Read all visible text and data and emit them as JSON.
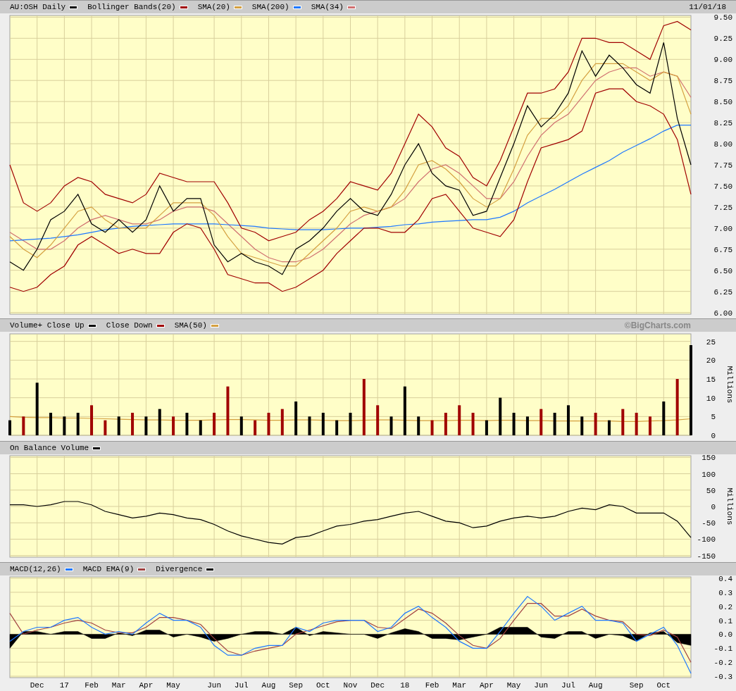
{
  "panels": [
    {
      "date": "11/01/18",
      "chart_data": {
        "type": "line",
        "categories": [
          null,
          null,
          null,
          null,
          null,
          null,
          null,
          null,
          null,
          null,
          null,
          null,
          null,
          null,
          null,
          null,
          null,
          null,
          null,
          null,
          null,
          null,
          null,
          null,
          null,
          null,
          null,
          null,
          null,
          null,
          null,
          null,
          null,
          null,
          null,
          null,
          null,
          null,
          null,
          null,
          null,
          null,
          null,
          null,
          null,
          null,
          null,
          null,
          null,
          null,
          null
        ],
        "ylim": [
          5.98,
          9.52
        ],
        "grid": true,
        "yticks": [
          {
            "value": 6,
            "label": "6.00"
          },
          {
            "value": 6.25,
            "label": "6.25"
          },
          {
            "value": 6.5,
            "label": "6.50"
          },
          {
            "value": 6.75,
            "label": "6.75"
          },
          {
            "value": 7,
            "label": "7.00"
          },
          {
            "value": 7.25,
            "label": "7.25"
          },
          {
            "value": 7.5,
            "label": "7.50"
          },
          {
            "value": 7.75,
            "label": "7.75"
          },
          {
            "value": 8,
            "label": "8.00"
          },
          {
            "value": 8.25,
            "label": "8.25"
          },
          {
            "value": 8.5,
            "label": "8.50"
          },
          {
            "value": 8.75,
            "label": "8.75"
          },
          {
            "value": 9,
            "label": "9.00"
          },
          {
            "value": 9.25,
            "label": "9.25"
          },
          {
            "value": 9.5,
            "label": "9.50"
          }
        ],
        "series": [
          {
            "name": "AU:OSH Daily",
            "color": "#000000",
            "values": [
              6.6,
              6.5,
              6.75,
              7.1,
              7.2,
              7.4,
              7.05,
              6.95,
              7.1,
              6.95,
              7.1,
              7.5,
              7.2,
              7.35,
              7.35,
              6.8,
              6.6,
              6.7,
              6.6,
              6.55,
              6.45,
              6.75,
              6.85,
              7.0,
              7.2,
              7.35,
              7.2,
              7.15,
              7.4,
              7.75,
              8.0,
              7.65,
              7.5,
              7.45,
              7.15,
              7.2,
              7.6,
              8.0,
              8.45,
              8.2,
              8.35,
              8.6,
              9.1,
              8.8,
              9.05,
              8.9,
              8.7,
              8.6,
              9.2,
              8.3,
              7.75
            ]
          },
          {
            "name": "Bollinger Bands(20)",
            "color": "#a00000",
            "values": [
              7.75,
              7.3,
              7.2,
              7.3,
              7.5,
              7.6,
              7.55,
              7.4,
              7.35,
              7.3,
              7.4,
              7.65,
              7.6,
              7.55,
              7.55,
              7.55,
              7.3,
              7.0,
              6.95,
              6.85,
              6.9,
              6.95,
              7.1,
              7.2,
              7.35,
              7.55,
              7.5,
              7.45,
              7.65,
              8.0,
              8.35,
              8.2,
              7.95,
              7.85,
              7.6,
              7.5,
              7.8,
              8.2,
              8.6,
              8.6,
              8.65,
              8.85,
              9.25,
              9.25,
              9.2,
              9.2,
              9.1,
              9.0,
              9.4,
              9.45,
              9.35
            ]
          },
          {
            "color": "#a00000",
            "values": [
              6.3,
              6.25,
              6.3,
              6.45,
              6.55,
              6.8,
              6.9,
              6.8,
              6.7,
              6.75,
              6.7,
              6.7,
              6.95,
              7.05,
              7.0,
              6.75,
              6.45,
              6.4,
              6.35,
              6.35,
              6.25,
              6.3,
              6.4,
              6.5,
              6.7,
              6.85,
              7.0,
              7.0,
              6.95,
              6.95,
              7.1,
              7.35,
              7.4,
              7.2,
              7.0,
              6.95,
              6.9,
              7.1,
              7.55,
              7.95,
              8.0,
              8.05,
              8.15,
              8.6,
              8.65,
              8.65,
              8.5,
              8.45,
              8.35,
              8.05,
              7.4
            ]
          },
          {
            "name": "SMA(20)",
            "color": "#d4a040",
            "values": [
              6.9,
              6.75,
              6.65,
              6.8,
              7.0,
              7.2,
              7.25,
              7.1,
              7.0,
              7.0,
              7.0,
              7.15,
              7.3,
              7.3,
              7.3,
              7.15,
              6.9,
              6.7,
              6.65,
              6.6,
              6.55,
              6.55,
              6.7,
              6.85,
              7.0,
              7.2,
              7.25,
              7.2,
              7.25,
              7.45,
              7.75,
              7.8,
              7.7,
              7.55,
              7.35,
              7.25,
              7.35,
              7.7,
              8.1,
              8.3,
              8.3,
              8.45,
              8.75,
              8.95,
              8.95,
              8.95,
              8.85,
              8.75,
              8.85,
              8.8,
              8.35
            ]
          },
          {
            "name": "SMA(200)",
            "color": "#1e78ff",
            "values": [
              6.85,
              6.86,
              6.87,
              6.88,
              6.9,
              6.92,
              6.95,
              6.98,
              7.0,
              7.02,
              7.03,
              7.04,
              7.05,
              7.05,
              7.05,
              7.05,
              7.04,
              7.03,
              7.02,
              7.0,
              6.99,
              6.98,
              6.98,
              6.98,
              6.99,
              7.0,
              7.0,
              7.01,
              7.02,
              7.04,
              7.05,
              7.07,
              7.08,
              7.09,
              7.1,
              7.1,
              7.13,
              7.2,
              7.3,
              7.38,
              7.46,
              7.55,
              7.64,
              7.72,
              7.8,
              7.9,
              7.98,
              8.06,
              8.15,
              8.22,
              8.22
            ]
          },
          {
            "name": "SMA(34)",
            "color": "#d07070",
            "values": [
              6.95,
              6.85,
              6.75,
              6.75,
              6.85,
              7.0,
              7.1,
              7.15,
              7.1,
              7.05,
              7.05,
              7.1,
              7.2,
              7.25,
              7.25,
              7.2,
              7.05,
              6.9,
              6.75,
              6.65,
              6.6,
              6.6,
              6.65,
              6.75,
              6.9,
              7.05,
              7.15,
              7.2,
              7.25,
              7.35,
              7.55,
              7.7,
              7.75,
              7.65,
              7.5,
              7.35,
              7.35,
              7.55,
              7.85,
              8.1,
              8.25,
              8.35,
              8.55,
              8.75,
              8.85,
              8.9,
              8.9,
              8.8,
              8.85,
              8.8,
              8.55
            ]
          }
        ]
      }
    },
    {
      "credit": "©BigCharts.com",
      "chart_data": {
        "type": "bar",
        "ylabel": "Millions",
        "categories": [
          null,
          null,
          null,
          null,
          null,
          null,
          null,
          null,
          null,
          null,
          null,
          null,
          null,
          null,
          null,
          null,
          null,
          null,
          null,
          null,
          null,
          null,
          null,
          null,
          null,
          null,
          null,
          null,
          null,
          null,
          null,
          null,
          null,
          null,
          null,
          null,
          null,
          null,
          null,
          null,
          null,
          null,
          null,
          null,
          null,
          null,
          null,
          null,
          null,
          null,
          null
        ],
        "ylim": [
          0,
          27
        ],
        "grid": true,
        "yticks": [
          {
            "value": 0,
            "label": "0"
          },
          {
            "value": 5,
            "label": "5"
          },
          {
            "value": 10,
            "label": "10"
          },
          {
            "value": 15,
            "label": "15"
          },
          {
            "value": 20,
            "label": "20"
          },
          {
            "value": 25,
            "label": "25"
          }
        ],
        "series": [
          {
            "name": "Volume+ Close Up",
            "color": "#000000",
            "values": [
              4,
              null,
              14,
              6,
              5,
              6,
              null,
              null,
              5,
              null,
              5,
              7,
              null,
              6,
              4,
              null,
              null,
              5,
              null,
              null,
              null,
              9,
              5,
              6,
              4,
              6,
              null,
              null,
              5,
              13,
              5,
              null,
              null,
              null,
              null,
              4,
              10,
              6,
              5,
              null,
              6,
              8,
              5,
              null,
              4,
              null,
              null,
              null,
              9,
              null,
              24
            ]
          },
          {
            "name": "Close Down",
            "color": "#a00000",
            "values": [
              null,
              5,
              null,
              null,
              null,
              null,
              8,
              4,
              null,
              6,
              null,
              null,
              5,
              null,
              null,
              6,
              13,
              null,
              4,
              6,
              7,
              null,
              null,
              null,
              null,
              null,
              15,
              8,
              null,
              null,
              null,
              4,
              6,
              8,
              6,
              null,
              null,
              null,
              null,
              7,
              null,
              null,
              null,
              6,
              null,
              7,
              6,
              5,
              null,
              15,
              null
            ]
          },
          {
            "name": "SMA(50)",
            "type": "line",
            "color": "#d4a040",
            "values": [
              5,
              4.8,
              4.7,
              4.7,
              4.6,
              4.6,
              4.5,
              4.4,
              4.3,
              4.2,
              4.1,
              4.1,
              4.0,
              4.0,
              4.0,
              4.1,
              4.2,
              4.2,
              4.1,
              4.0,
              4.0,
              4.1,
              4.1,
              4.0,
              3.9,
              3.9,
              4.0,
              4.1,
              4.1,
              4.0,
              3.9,
              3.9,
              3.9,
              4.0,
              4.0,
              3.9,
              4.0,
              4.0,
              3.9,
              3.9,
              3.8,
              3.8,
              3.8,
              3.8,
              3.8,
              3.7,
              3.7,
              3.8,
              3.9,
              4.1,
              4.4
            ]
          }
        ]
      }
    },
    {
      "chart_data": {
        "type": "line",
        "ylabel": "Millions",
        "categories": [
          null,
          null,
          null,
          null,
          null,
          null,
          null,
          null,
          null,
          null,
          null,
          null,
          null,
          null,
          null,
          null,
          null,
          null,
          null,
          null,
          null,
          null,
          null,
          null,
          null,
          null,
          null,
          null,
          null,
          null,
          null,
          null,
          null,
          null,
          null,
          null,
          null,
          null,
          null,
          null,
          null,
          null,
          null,
          null,
          null,
          null,
          null,
          null,
          null,
          null,
          null
        ],
        "ylim": [
          -155,
          155
        ],
        "grid": true,
        "yticks": [
          {
            "value": -150,
            "label": "-150"
          },
          {
            "value": -100,
            "label": "-100"
          },
          {
            "value": -50,
            "label": "-50"
          },
          {
            "value": 0,
            "label": "0"
          },
          {
            "value": 50,
            "label": "50"
          },
          {
            "value": 100,
            "label": "100"
          },
          {
            "value": 150,
            "label": "150"
          }
        ],
        "series": [
          {
            "name": "On Balance Volume",
            "color": "#000000",
            "values": [
              5,
              5,
              0,
              5,
              15,
              15,
              5,
              -15,
              -25,
              -35,
              -30,
              -20,
              -25,
              -35,
              -40,
              -55,
              -75,
              -90,
              -100,
              -110,
              -115,
              -95,
              -90,
              -75,
              -60,
              -55,
              -45,
              -40,
              -30,
              -20,
              -15,
              -30,
              -45,
              -50,
              -65,
              -60,
              -45,
              -35,
              -30,
              -35,
              -30,
              -15,
              -5,
              -10,
              5,
              0,
              -20,
              -20,
              -20,
              -45,
              -95
            ]
          }
        ]
      }
    },
    {
      "chart_data": {
        "type": "line",
        "categories": [
          null,
          null,
          "Dec",
          null,
          "17",
          null,
          "Feb",
          null,
          "Mar",
          null,
          "Apr",
          null,
          "May",
          null,
          null,
          "Jun",
          null,
          "Jul",
          null,
          "Aug",
          null,
          "Sep",
          null,
          "Oct",
          null,
          "Nov",
          null,
          "Dec",
          null,
          "18",
          null,
          "Feb",
          null,
          "Mar",
          null,
          "Apr",
          null,
          "May",
          null,
          "Jun",
          null,
          "Jul",
          null,
          "Aug",
          null,
          null,
          "Sep",
          null,
          "Oct",
          null,
          null
        ],
        "ylim": [
          -0.31,
          0.41
        ],
        "grid": true,
        "yticks": [
          {
            "value": -0.3,
            "label": "-0.3"
          },
          {
            "value": -0.2,
            "label": "-0.2"
          },
          {
            "value": -0.1,
            "label": "-0.1"
          },
          {
            "value": 0,
            "label": "0.0"
          },
          {
            "value": 0.1,
            "label": "0.1"
          },
          {
            "value": 0.2,
            "label": "0.2"
          },
          {
            "value": 0.3,
            "label": "0.3"
          },
          {
            "value": 0.4,
            "label": "0.4"
          }
        ],
        "series": [
          {
            "name": "MACD(12,26)",
            "color": "#1e78ff",
            "values": [
              -0.05,
              0.02,
              0.05,
              0.05,
              0.1,
              0.12,
              0.05,
              0.0,
              0.02,
              0.0,
              0.08,
              0.15,
              0.1,
              0.1,
              0.05,
              -0.08,
              -0.15,
              -0.15,
              -0.1,
              -0.08,
              -0.08,
              0.05,
              0.02,
              0.08,
              0.1,
              0.1,
              0.1,
              0.02,
              0.05,
              0.15,
              0.2,
              0.12,
              0.05,
              -0.05,
              -0.1,
              -0.1,
              0.02,
              0.15,
              0.27,
              0.2,
              0.1,
              0.15,
              0.2,
              0.1,
              0.1,
              0.08,
              -0.05,
              0.0,
              0.05,
              -0.08,
              -0.28
            ]
          },
          {
            "name": "MACD EMA(9)",
            "color": "#a04040",
            "values": [
              0.15,
              0.0,
              0.03,
              0.05,
              0.08,
              0.1,
              0.08,
              0.03,
              0.01,
              0.01,
              0.05,
              0.12,
              0.12,
              0.1,
              0.07,
              -0.03,
              -0.12,
              -0.15,
              -0.12,
              -0.1,
              -0.08,
              0.0,
              0.03,
              0.06,
              0.09,
              0.1,
              0.1,
              0.05,
              0.04,
              0.11,
              0.18,
              0.15,
              0.08,
              -0.01,
              -0.08,
              -0.1,
              -0.03,
              0.1,
              0.22,
              0.22,
              0.13,
              0.13,
              0.18,
              0.13,
              0.1,
              0.09,
              0.0,
              -0.01,
              0.03,
              -0.02,
              -0.2
            ]
          },
          {
            "name": "Divergence",
            "type": "area",
            "color": "#000000",
            "values": [
              -0.1,
              0.02,
              0.02,
              0,
              0.02,
              0.02,
              -0.03,
              -0.03,
              0.01,
              -0.01,
              0.03,
              0.03,
              -0.02,
              0,
              -0.02,
              -0.05,
              -0.03,
              0,
              0.02,
              0.02,
              0,
              0.05,
              -0.01,
              0.02,
              0.01,
              0,
              0,
              -0.03,
              0.01,
              0.04,
              0.02,
              -0.03,
              -0.03,
              -0.04,
              -0.02,
              0,
              0.05,
              0.05,
              0.05,
              -0.02,
              -0.03,
              0.02,
              0.02,
              -0.03,
              0,
              -0.01,
              -0.05,
              0.01,
              0.02,
              -0.06,
              -0.08
            ]
          }
        ]
      }
    }
  ]
}
